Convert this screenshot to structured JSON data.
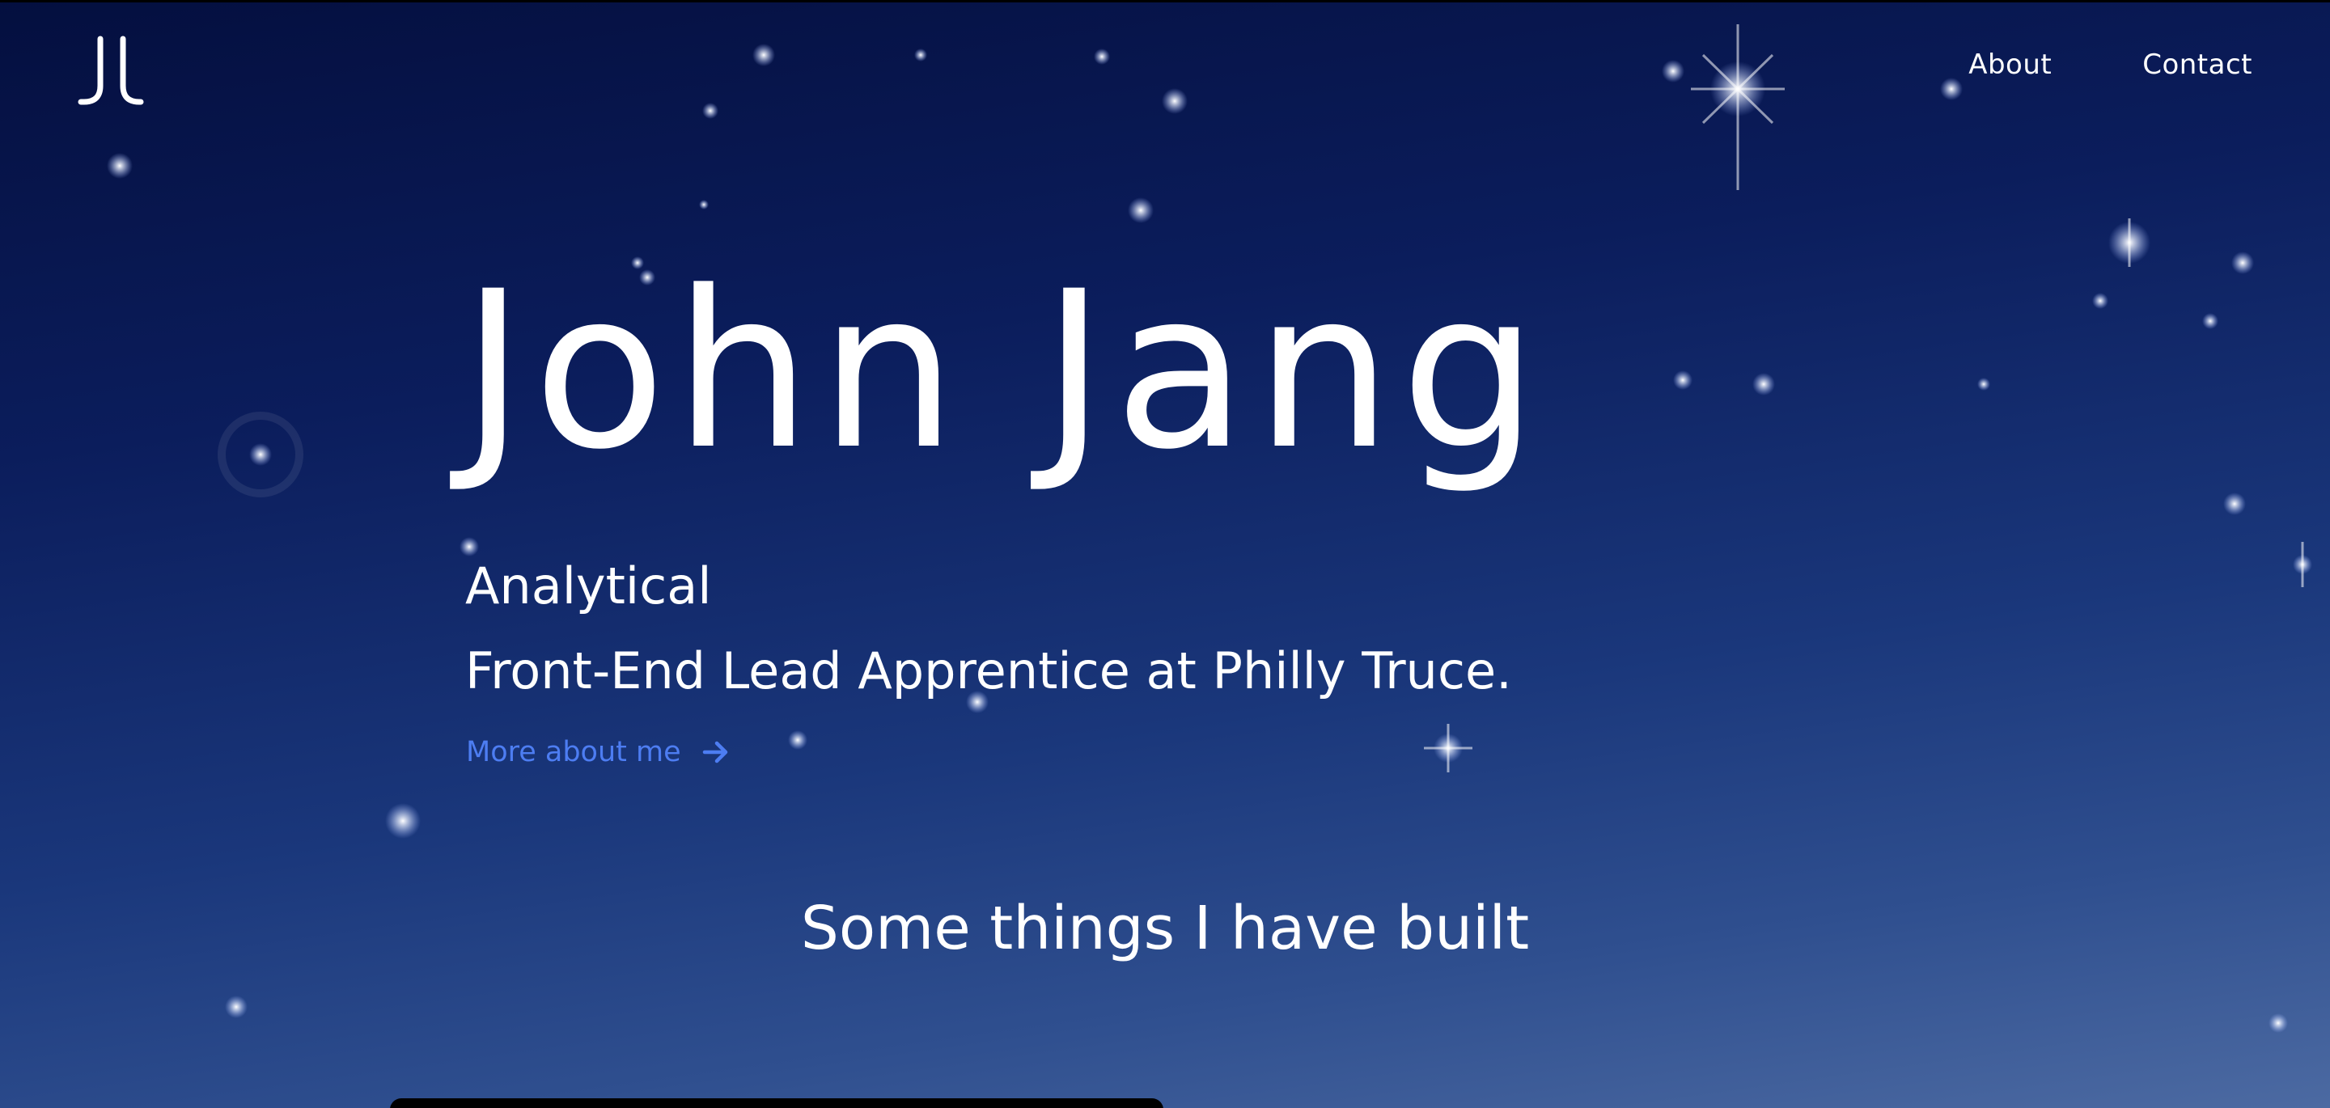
{
  "nav": {
    "logo_alt": "JJ",
    "links": [
      "About",
      "Contact"
    ]
  },
  "hero": {
    "name": "John Jang",
    "trait": "Analytical",
    "role": "Front-End Lead Apprentice at Philly Truce.",
    "more_link": "More about me"
  },
  "projects": {
    "heading": "Some things I have built"
  },
  "colors": {
    "background_top": "#040f3f",
    "background_bottom": "#4c6aa2",
    "link_accent": "#4d7df2",
    "text": "#ffffff"
  },
  "icons": {
    "logo": "jj-monogram-logo",
    "more_arrow": "arrow-right-icon"
  }
}
